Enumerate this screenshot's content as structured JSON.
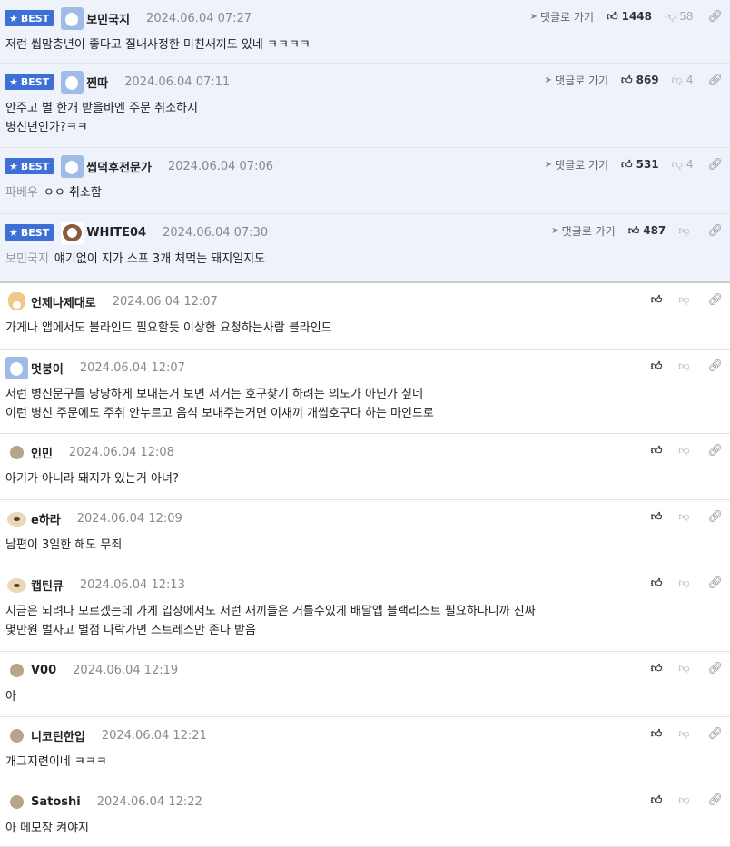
{
  "ui": {
    "best_label": "BEST",
    "reply_label": "댓글로 가기",
    "icons": {
      "star": "star-icon",
      "reply": "paper-plane-icon",
      "like": "thumbs-up-icon",
      "dislike": "thumbs-down-icon",
      "link": "link-icon"
    }
  },
  "comments": [
    {
      "best": true,
      "nick": "보민국지",
      "date": "2024.06.04 07:27",
      "likes": "1448",
      "dislikes": "58",
      "avatar": "bear",
      "lines": [
        "저런 씹맘충년이 좋다고 질내사정한 미친새끼도 있네 ㅋㅋㅋㅋ"
      ],
      "quote": ""
    },
    {
      "best": true,
      "nick": "찐따",
      "date": "2024.06.04 07:11",
      "likes": "869",
      "dislikes": "4",
      "avatar": "bear",
      "lines": [
        "안주고 별 한개 받을바엔 주문 취소하지",
        "병신년인가?ㅋㅋ"
      ],
      "quote": ""
    },
    {
      "best": true,
      "nick": "씹덕후전문가",
      "date": "2024.06.04 07:06",
      "likes": "531",
      "dislikes": "4",
      "avatar": "bear",
      "lines": [
        "ㅇㅇ 취소함"
      ],
      "quote": "파베우"
    },
    {
      "best": true,
      "nick": "WHITE04",
      "date": "2024.06.04 07:30",
      "likes": "487",
      "dislikes": "",
      "avatar": "dog",
      "lines": [
        "얘기없이 지가 스프 3개 처먹는 돼지일지도"
      ],
      "quote": "보민국지"
    },
    {
      "best": false,
      "nick": "언제나제대로",
      "date": "2024.06.04 12:07",
      "likes": "",
      "dislikes": "",
      "avatar": "fox",
      "lines": [
        "가게나 앱에서도 블라인드 필요할듯 이상한 요청하는사람 블라인드"
      ],
      "quote": ""
    },
    {
      "best": false,
      "nick": "멋붕이",
      "date": "2024.06.04 12:07",
      "likes": "",
      "dislikes": "",
      "avatar": "bear",
      "lines": [
        "저런 병신문구를 당당하게 보내는거 보면 저거는 호구찾기 하려는 의도가 아닌가 싶네",
        "이런 병신 주문에도 주취 안누르고 음식 보내주는거면 이새끼 개씹호구다 하는 마인드로"
      ],
      "quote": ""
    },
    {
      "best": false,
      "nick": "인민",
      "date": "2024.06.04 12:08",
      "likes": "",
      "dislikes": "",
      "avatar": "dot",
      "lines": [
        "아기가 아니라 돼지가 있는거 아녀?"
      ],
      "quote": ""
    },
    {
      "best": false,
      "nick": "e하라",
      "date": "2024.06.04 12:09",
      "likes": "",
      "dislikes": "",
      "avatar": "pup",
      "lines": [
        "남편이 3일한 해도 무죄"
      ],
      "quote": ""
    },
    {
      "best": false,
      "nick": "캡틴큐",
      "date": "2024.06.04 12:13",
      "likes": "",
      "dislikes": "",
      "avatar": "pup",
      "lines": [
        "지금은 되려나 모르겠는데 가게 입장에서도 저런 새끼들은 거를수있게 배달앱 블랙리스트 필요하다니까 진짜",
        "몇만원 벌자고 별점 나락가면 스트레스만 존나 받음"
      ],
      "quote": ""
    },
    {
      "best": false,
      "nick": "V00",
      "date": "2024.06.04 12:19",
      "likes": "",
      "dislikes": "",
      "avatar": "dot",
      "lines": [
        "아"
      ],
      "quote": ""
    },
    {
      "best": false,
      "nick": "니코틴한입",
      "date": "2024.06.04 12:21",
      "likes": "",
      "dislikes": "",
      "avatar": "dot",
      "lines": [
        "개그지련이네 ㅋㅋㅋ"
      ],
      "quote": ""
    },
    {
      "best": false,
      "nick": "Satoshi",
      "date": "2024.06.04 12:22",
      "likes": "",
      "dislikes": "",
      "avatar": "dot",
      "lines": [
        "아 메모장 켜야지"
      ],
      "quote": ""
    }
  ]
}
